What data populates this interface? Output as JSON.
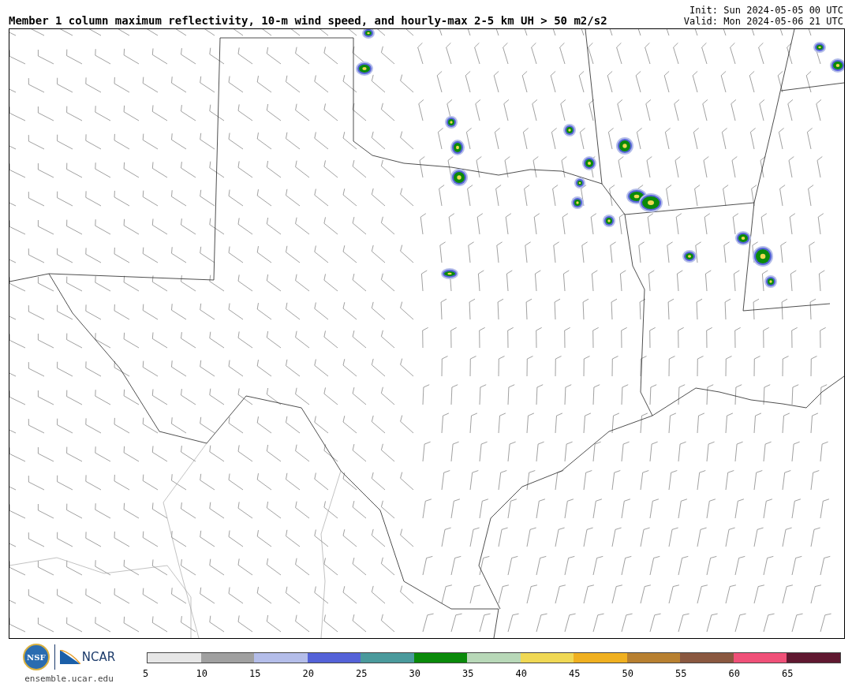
{
  "title": "Member 1 column maximum reflectivity, 10-m wind speed, and hourly-max 2-5 km UH > 50 m2/s2",
  "init": "Init: Sun 2024-05-05 00 UTC",
  "valid": "Valid: Mon 2024-05-06 21 UTC",
  "logos": {
    "nsf": "NSF",
    "ncar": "NCAR",
    "url": "ensemble.ucar.edu"
  },
  "colorbar": {
    "bins": [
      {
        "color": "#e6e6e6"
      },
      {
        "color": "#a0a0a0"
      },
      {
        "color": "#b4bde9"
      },
      {
        "color": "#5462d8"
      },
      {
        "color": "#4a9a9c"
      },
      {
        "color": "#0a8a0a"
      },
      {
        "color": "#b8d8b8"
      },
      {
        "color": "#f0d854"
      },
      {
        "color": "#f0b020"
      },
      {
        "color": "#b88030"
      },
      {
        "color": "#8a5840"
      },
      {
        "color": "#f05078"
      },
      {
        "color": "#601830"
      }
    ],
    "labels": [
      "5",
      "10",
      "15",
      "20",
      "25",
      "30",
      "35",
      "40",
      "45",
      "50",
      "55",
      "60",
      "65"
    ]
  }
}
